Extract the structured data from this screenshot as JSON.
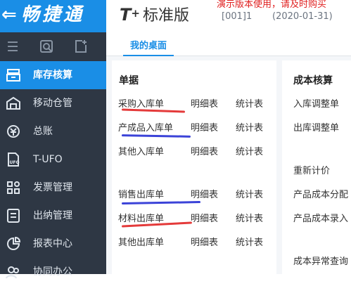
{
  "brand": {
    "arrow": "⇐",
    "name": "畅捷通",
    "color": "#1a8ee6"
  },
  "header": {
    "product_t": "T",
    "product_plus": "+",
    "edition": "标准版",
    "demo_notice": "演示版本使用，请及时购买",
    "account": "[001]1",
    "date": "(2020-01-31)"
  },
  "toolbar": {
    "icons": [
      "menu-icon",
      "search-doc-icon",
      "new-doc-icon"
    ]
  },
  "nav": [
    {
      "label": "库存核算",
      "icon": "inventory-icon",
      "active": true
    },
    {
      "label": "移动仓管",
      "icon": "mobile-warehouse-icon"
    },
    {
      "label": "总账",
      "icon": "ledger-icon"
    },
    {
      "label": "T-UFO",
      "icon": "ufo-icon"
    },
    {
      "label": "发票管理",
      "icon": "invoice-icon"
    },
    {
      "label": "出纳管理",
      "icon": "cashier-icon"
    },
    {
      "label": "报表中心",
      "icon": "report-icon"
    },
    {
      "label": "协同办公",
      "icon": "collab-icon"
    }
  ],
  "tabs": {
    "desktop": "我的桌面"
  },
  "documents": {
    "title": "单据",
    "rows": [
      {
        "name": "采购入库单",
        "detail": "明细表",
        "stats": "统计表"
      },
      {
        "name": "产成品入库单",
        "detail": "明细表",
        "stats": "统计表"
      },
      {
        "name": "其他入库单",
        "detail": "明细表",
        "stats": "统计表"
      },
      {
        "name": "销售出库单",
        "detail": "明细表",
        "stats": "统计表"
      },
      {
        "name": "材料出库单",
        "detail": "明细表",
        "stats": "统计表"
      },
      {
        "name": "其他出库单",
        "detail": "明细表",
        "stats": "统计表"
      }
    ]
  },
  "cost": {
    "title": "成本核算",
    "items": [
      "入库调整单",
      "出库调整单",
      "重新计价",
      "产品成本分配",
      "产品成本录入",
      "成本异常查询"
    ]
  },
  "colors": {
    "sidebar": "#2e3744",
    "accent": "#1a8ee6",
    "notice": "#e02020",
    "mark_red": "#e43a3a",
    "mark_blue": "#3b43d8"
  }
}
